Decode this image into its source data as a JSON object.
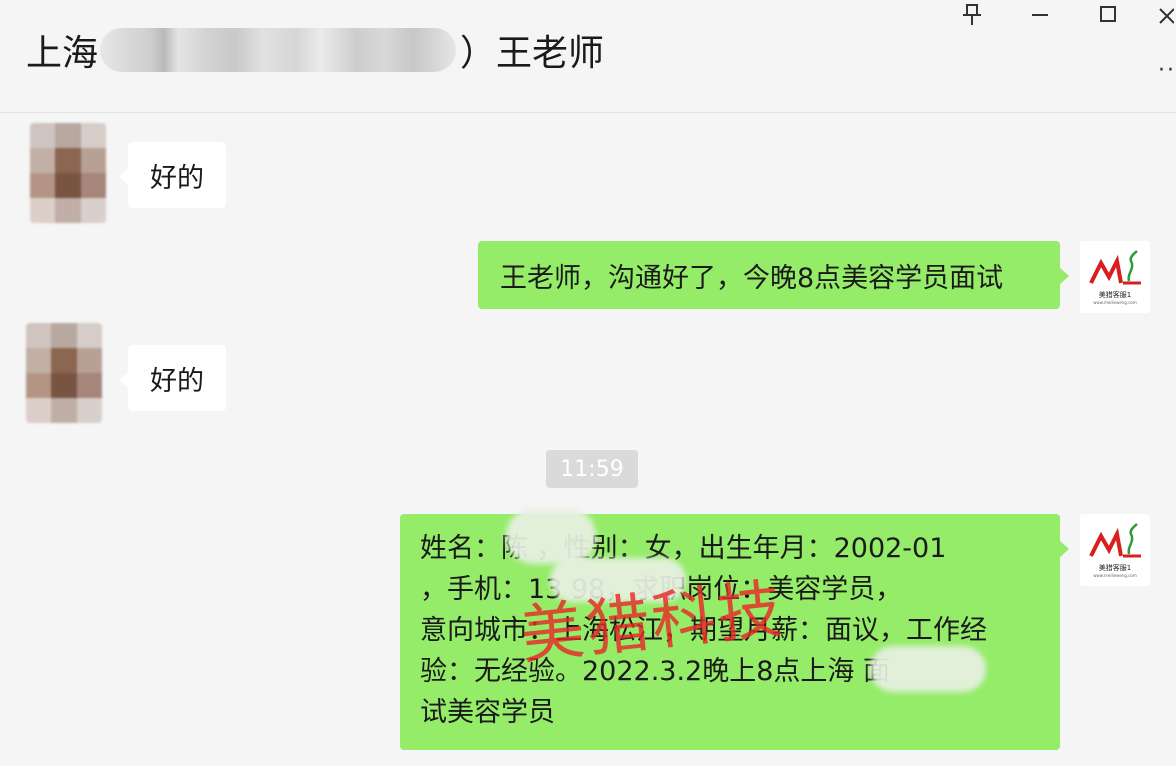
{
  "header": {
    "title_prefix": "上海",
    "title_suffix": "）王老师"
  },
  "window_controls": {
    "pin": "⍗",
    "minimize": "—",
    "maximize": "☐",
    "close": "×",
    "more": "··"
  },
  "messages": [
    {
      "side": "left",
      "text": "好的"
    },
    {
      "side": "right",
      "text": "王老师，沟通好了，今晚8点美容学员面试"
    },
    {
      "side": "left",
      "text": "好的"
    },
    {
      "side": "right",
      "text": "姓名：陈 ，性别：女，出生年月：2002-01\n，手机：13 98，求职岗位：美容学员，\n意向城市：上海松江，期望月薪：面议，工作经\n验：无经验。2022.3.2晚上8点上海 面\n试美容学员"
    }
  ],
  "timestamp": "11:59",
  "logo": {
    "mark": "ML",
    "sub": "美猎客服1",
    "sub2": "www.meilieweng.com"
  },
  "watermark": "美猎科技",
  "colors": {
    "own_bubble": "#95ec69",
    "other_bubble": "#ffffff",
    "background": "#f5f5f5",
    "watermark": "#e82828",
    "logo_red": "#d81e1e",
    "logo_green": "#2e9a3a"
  }
}
